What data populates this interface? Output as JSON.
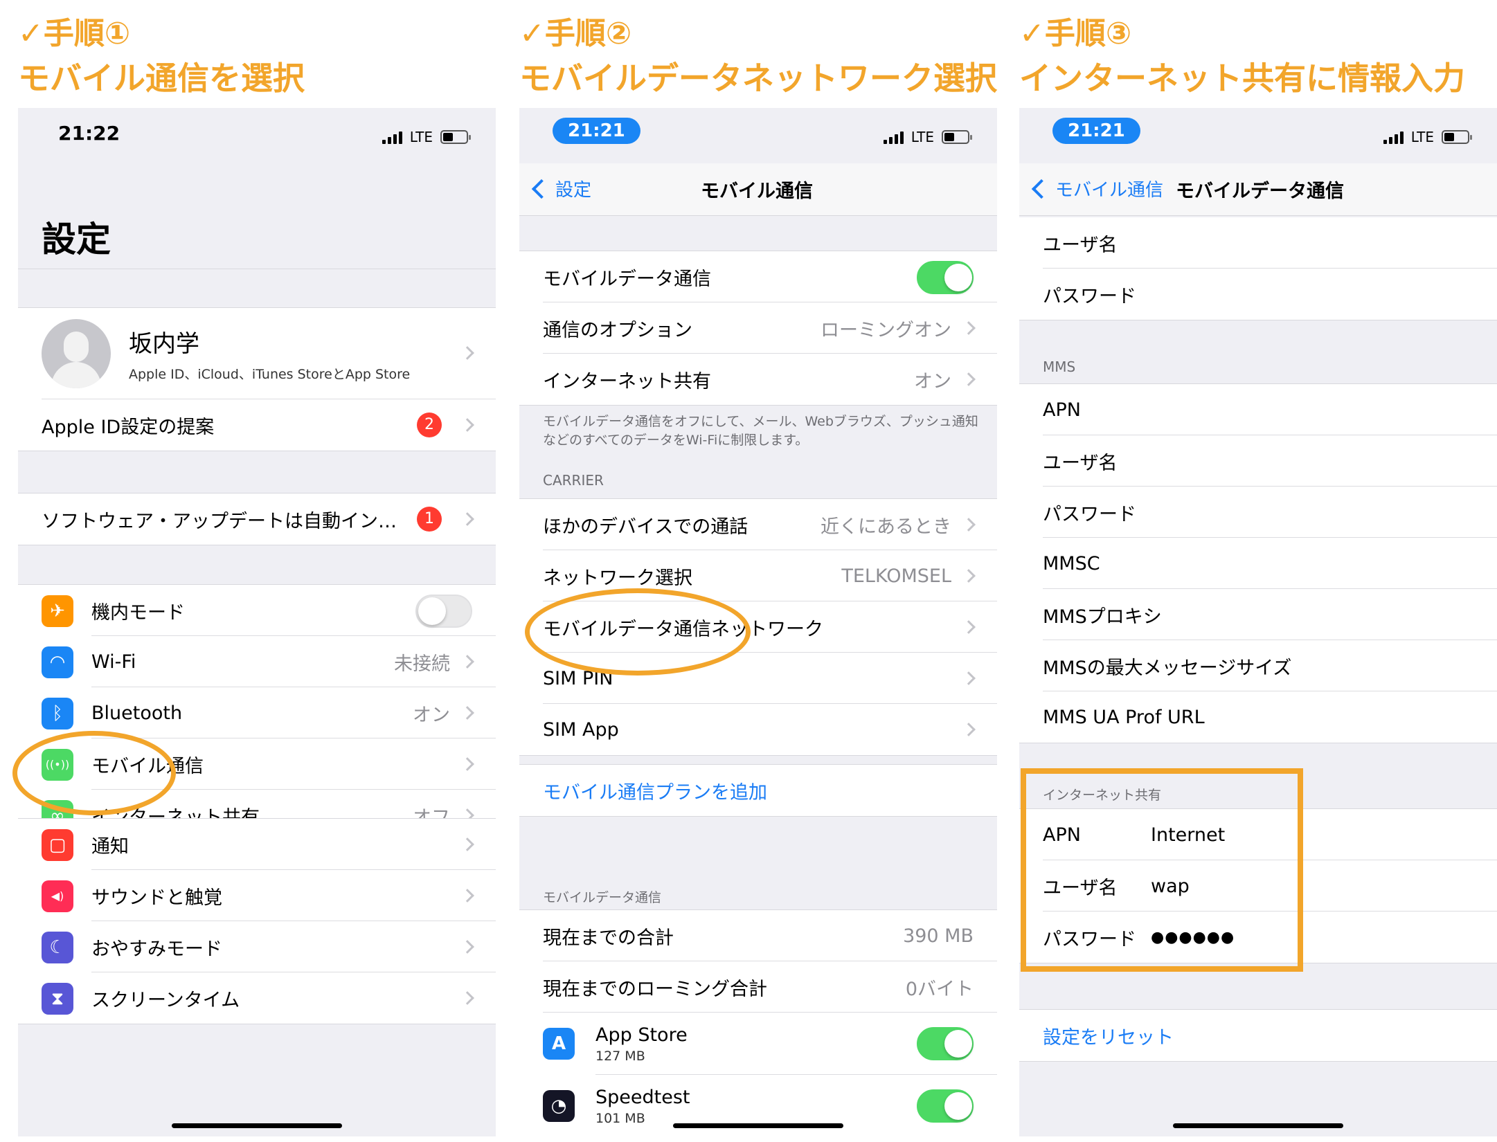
{
  "steps": [
    {
      "check": "✓手順①",
      "title": "モバイル通信を選択"
    },
    {
      "check": "✓手順②",
      "title": "モバイルデータネットワーク選択"
    },
    {
      "check": "✓手順③",
      "title": "インターネット共有に情報入力"
    }
  ],
  "status": {
    "time1": "21:22",
    "time2": "21:21",
    "time3": "21:21",
    "network": "LTE"
  },
  "screen1": {
    "large_title": "設定",
    "profile": {
      "name": "坂内学",
      "sub": "Apple ID、iCloud、iTunes StoreとApp Store"
    },
    "appleid_suggest": {
      "label": "Apple ID設定の提案",
      "badge": "2"
    },
    "software_update": {
      "label": "ソフトウェア・アップデートは自動イン…",
      "badge": "1"
    },
    "rows": [
      {
        "label": "機内モード",
        "value": "",
        "icon": "airplane-icon",
        "color": "#ff9500",
        "glyph": "✈"
      },
      {
        "label": "Wi-Fi",
        "value": "未接続",
        "icon": "wifi-icon",
        "color": "#1a86f5",
        "glyph": "◠"
      },
      {
        "label": "Bluetooth",
        "value": "オン",
        "icon": "bluetooth-icon",
        "color": "#1a86f5",
        "glyph": "ᛒ"
      },
      {
        "label": "モバイル通信",
        "value": "",
        "icon": "antenna-icon",
        "color": "#4cd964",
        "glyph": "((•))"
      },
      {
        "label": "インターネット共有",
        "value": "オフ",
        "icon": "hotspot-icon",
        "color": "#4cd964",
        "glyph": "∞"
      }
    ],
    "rows2": [
      {
        "label": "通知",
        "icon": "notification-icon",
        "color": "#ff3b30",
        "glyph": "▢"
      },
      {
        "label": "サウンドと触覚",
        "icon": "sound-icon",
        "color": "#ff2d55",
        "glyph": "◀)"
      },
      {
        "label": "おやすみモード",
        "icon": "moon-icon",
        "color": "#5856d6",
        "glyph": "☾"
      },
      {
        "label": "スクリーンタイム",
        "icon": "hourglass-icon",
        "color": "#5856d6",
        "glyph": "⧗"
      }
    ]
  },
  "screen2": {
    "back": "設定",
    "title": "モバイル通信",
    "rows1": [
      {
        "label": "モバイルデータ通信",
        "value": ""
      },
      {
        "label": "通信のオプション",
        "value": "ローミングオン"
      },
      {
        "label": "インターネット共有",
        "value": "オン"
      }
    ],
    "note": "モバイルデータ通信をオフにして、メール、Webブラウズ、プッシュ通知などのすべてのデータをWi-Fiに制限します。",
    "carrier_label": "CARRIER",
    "rows2": [
      {
        "label": "ほかのデバイスでの通話",
        "value": "近くにあるとき"
      },
      {
        "label": "ネットワーク選択",
        "value": "TELKOMSEL"
      },
      {
        "label": "モバイルデータ通信ネットワーク",
        "value": ""
      },
      {
        "label": "SIM PIN",
        "value": ""
      },
      {
        "label": "SIM App",
        "value": ""
      }
    ],
    "add_plan": "モバイル通信プランを追加",
    "usage_label": "モバイルデータ通信",
    "usage": [
      {
        "label": "現在までの合計",
        "value": "390 MB"
      },
      {
        "label": "現在までのローミング合計",
        "value": "0バイト"
      }
    ],
    "apps": [
      {
        "name": "App Store",
        "size": "127 MB"
      },
      {
        "name": "Speedtest",
        "size": "101 MB"
      }
    ]
  },
  "screen3": {
    "back": "モバイル通信",
    "title": "モバイルデータ通信",
    "top_rows": [
      "ユーザ名",
      "パスワード"
    ],
    "mms_label": "MMS",
    "mms_rows": [
      "APN",
      "ユーザ名",
      "パスワード",
      "MMSC",
      "MMSプロキシ",
      "MMSの最大メッセージサイズ",
      "MMS UA Prof URL"
    ],
    "hotspot_label": "インターネット共有",
    "hotspot_rows": [
      {
        "label": "APN",
        "value": "Internet"
      },
      {
        "label": "ユーザ名",
        "value": "wap"
      },
      {
        "label": "パスワード",
        "value": "●●●●●●"
      }
    ],
    "reset": "設定をリセット"
  },
  "accent_color": "#f2a52b"
}
